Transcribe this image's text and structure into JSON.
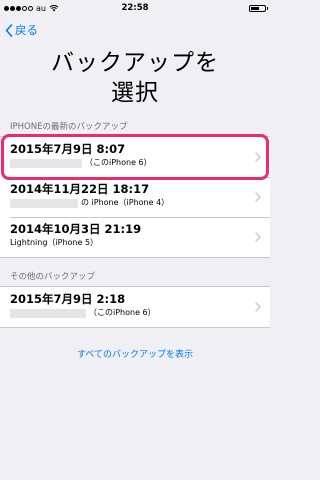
{
  "status": {
    "carrier": "au",
    "time": "22:58"
  },
  "nav": {
    "back_label": "戻る"
  },
  "title": {
    "line1": "バックアップを",
    "line2": "選択"
  },
  "section1": {
    "header": "IPHONEの最新のバックアップ",
    "rows": [
      {
        "date": "2015年7月9日 8:07",
        "device": "（このiPhone 6）"
      },
      {
        "date": "2014年11月22日 18:17",
        "device": "の iPhone（iPhone 4）"
      },
      {
        "date": "2014年10月3日 21:19",
        "device": "Lightning（iPhone 5）"
      }
    ]
  },
  "section2": {
    "header": "その他のバックアップ",
    "rows": [
      {
        "date": "2015年7月9日 2:18",
        "device": "（このiPhone 6）"
      }
    ]
  },
  "show_all_label": "すべてのバックアップを表示",
  "colors": {
    "accent": "#007aff",
    "highlight": "#ee2a6e"
  }
}
